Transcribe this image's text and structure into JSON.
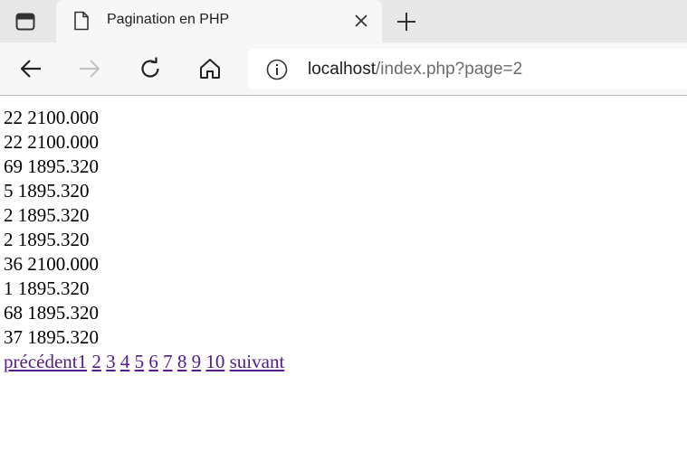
{
  "browser": {
    "tab_title": "Pagination en PHP",
    "url_host": "localhost",
    "url_path": "/index.php?page=2"
  },
  "rows": [
    {
      "id": "22",
      "value": "2100.000"
    },
    {
      "id": "22",
      "value": "2100.000"
    },
    {
      "id": "69",
      "value": "1895.320"
    },
    {
      "id": "5",
      "value": "1895.320"
    },
    {
      "id": "2",
      "value": "1895.320"
    },
    {
      "id": "2",
      "value": "1895.320"
    },
    {
      "id": "36",
      "value": "2100.000"
    },
    {
      "id": "1",
      "value": "1895.320"
    },
    {
      "id": "68",
      "value": "1895.320"
    },
    {
      "id": "37",
      "value": "1895.320"
    }
  ],
  "pagination": {
    "prev_label": "précédent",
    "pages": [
      "1",
      "2",
      "3",
      "4",
      "5",
      "6",
      "7",
      "8",
      "9",
      "10"
    ],
    "next_label": "suivant"
  },
  "colors": {
    "link": "#551a8b",
    "tabbar": "#e8e8e8",
    "toolbar": "#f7f7f7"
  }
}
